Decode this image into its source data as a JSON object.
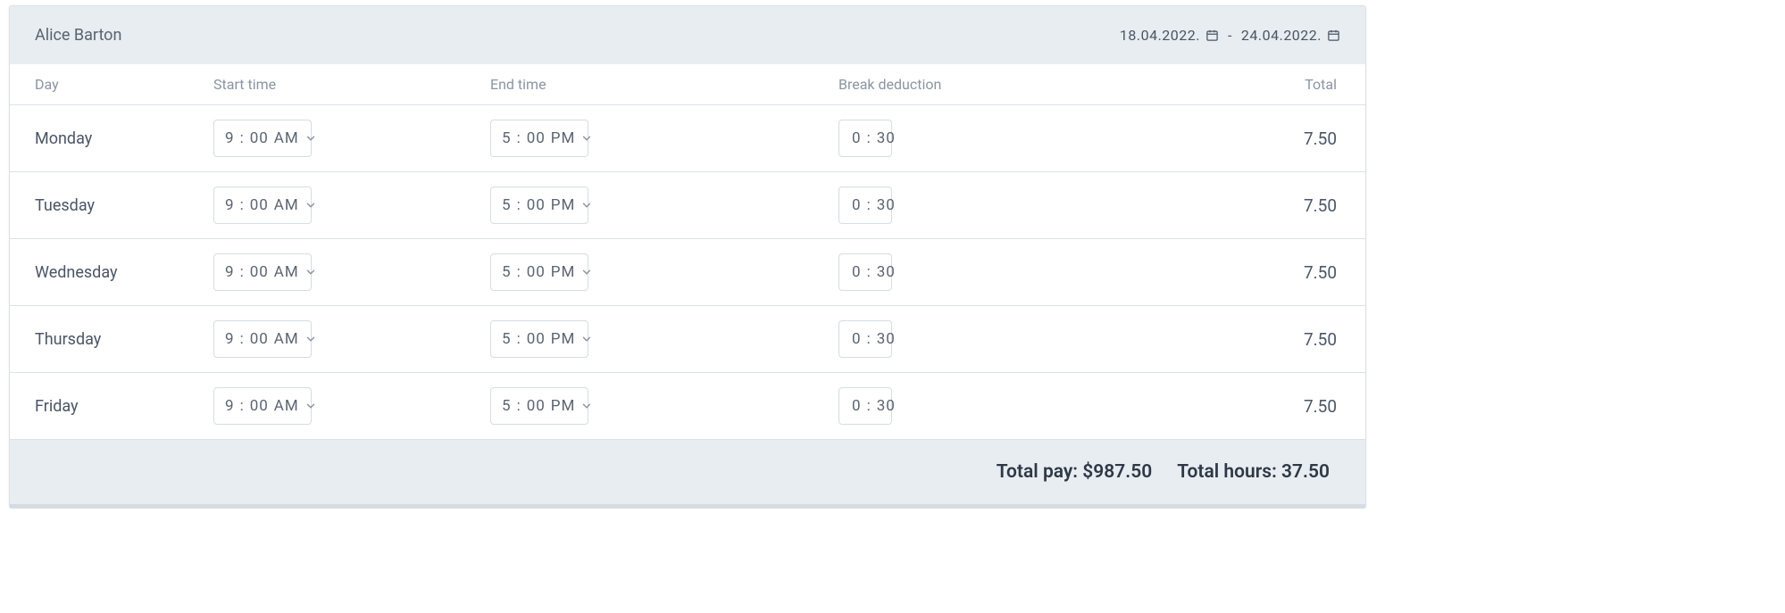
{
  "employee_name": "Alice Barton",
  "date_range": {
    "from": "18.04.2022.",
    "separator": "-",
    "to": "24.04.2022."
  },
  "columns": {
    "day": "Day",
    "start": "Start time",
    "end": "End time",
    "break": "Break deduction",
    "total": "Total"
  },
  "rows": [
    {
      "day": "Monday",
      "start_hh": "9",
      "start_mm": "00",
      "start_period": "AM",
      "end_hh": "5",
      "end_mm": "00",
      "end_period": "PM",
      "break_hh": "0",
      "break_mm": "30",
      "total": "7.50"
    },
    {
      "day": "Tuesday",
      "start_hh": "9",
      "start_mm": "00",
      "start_period": "AM",
      "end_hh": "5",
      "end_mm": "00",
      "end_period": "PM",
      "break_hh": "0",
      "break_mm": "30",
      "total": "7.50"
    },
    {
      "day": "Wednesday",
      "start_hh": "9",
      "start_mm": "00",
      "start_period": "AM",
      "end_hh": "5",
      "end_mm": "00",
      "end_period": "PM",
      "break_hh": "0",
      "break_mm": "30",
      "total": "7.50"
    },
    {
      "day": "Thursday",
      "start_hh": "9",
      "start_mm": "00",
      "start_period": "AM",
      "end_hh": "5",
      "end_mm": "00",
      "end_period": "PM",
      "break_hh": "0",
      "break_mm": "30",
      "total": "7.50"
    },
    {
      "day": "Friday",
      "start_hh": "9",
      "start_mm": "00",
      "start_period": "AM",
      "end_hh": "5",
      "end_mm": "00",
      "end_period": "PM",
      "break_hh": "0",
      "break_mm": "30",
      "total": "7.50"
    }
  ],
  "footer": {
    "pay_label": "Total pay: ",
    "pay_value": "$987.50",
    "hours_label": "Total hours: ",
    "hours_value": "37.50"
  },
  "time_sep": ":"
}
